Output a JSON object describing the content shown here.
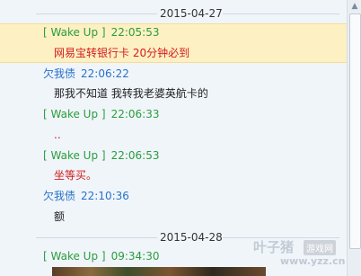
{
  "dates": [
    "2015-04-27",
    "2015-04-28"
  ],
  "messages": [
    {
      "sender": "[ Wake Up ]",
      "time": "22:05:53",
      "text": "网易宝转银行卡  20分钟必到"
    },
    {
      "sender": "欠我债",
      "time": "22:06:22",
      "text": "那我不知道 我转我老婆英航卡的"
    },
    {
      "sender": "[ Wake Up ]",
      "time": "22:06:33",
      "text": ".."
    },
    {
      "sender": "[ Wake Up ]",
      "time": "22:06:53",
      "text": "坐等买。"
    },
    {
      "sender": "欠我债",
      "time": "22:10:36",
      "text": "额"
    },
    {
      "sender": "[ Wake Up ]",
      "time": "09:34:30",
      "text": ""
    }
  ],
  "watermark": {
    "main": "叶子猪",
    "tag": "游戏网",
    "url": "www.yzz.cn"
  },
  "scrollbar": {
    "up_arrow": "▲"
  },
  "colors": {
    "green_sender": "#2a9d3c",
    "blue_sender": "#2872c8",
    "red_text": "#d21c1c",
    "highlight": "#fdf0c2"
  }
}
